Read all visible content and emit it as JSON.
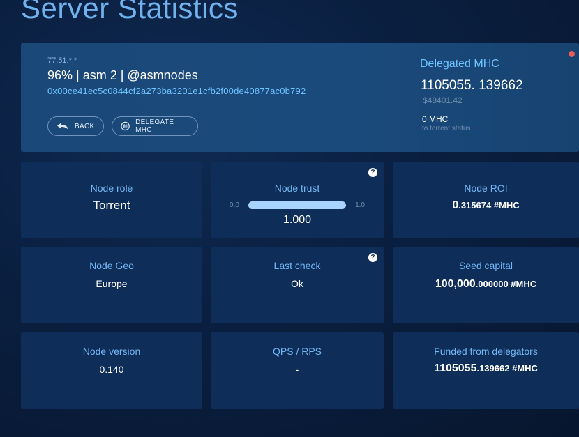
{
  "page": {
    "title": "Server Statistics"
  },
  "node": {
    "ip": "77.51.*.*",
    "name": "96% | asm 2 | @asmnodes",
    "address": "0x00ce41ec5c0844cf2a273ba3201e1cfb2f00de40877ac0b792",
    "back_label": "BACK",
    "delegate_label": "DELEGATE MHC"
  },
  "delegated": {
    "title": "Delegated MHC",
    "amount": "1105055. 139662",
    "usd": "$48401.42",
    "torrent_amount": "0 MHC",
    "torrent_status": "to torrent status"
  },
  "cards": {
    "role": {
      "label": "Node role",
      "value": "Torrent"
    },
    "trust": {
      "label": "Node trust",
      "min": "0.0",
      "max": "1.0",
      "value": "1.000",
      "level": 1.0
    },
    "roi": {
      "label": "Node ROI",
      "int": "0",
      "dec": ".315674 #MHC"
    },
    "geo": {
      "label": "Node Geo",
      "value": "Europe"
    },
    "check": {
      "label": "Last check",
      "value": "Ok"
    },
    "seed": {
      "label": "Seed capital",
      "int": "100,000",
      "dec": ".000000 #MHC"
    },
    "version": {
      "label": "Node version",
      "value": "0.140"
    },
    "qps": {
      "label": "QPS / RPS",
      "value": "-"
    },
    "funded": {
      "label": "Funded from delegators",
      "int": "1105055",
      "dec": ".139662 #MHC"
    }
  },
  "colors": {
    "accent": "#6fc3ff",
    "card_bg": "#0e2d59",
    "alert": "#ef5b5b"
  },
  "icons": {
    "back": "back-arrow-icon",
    "delegate": "hash-coin-icon",
    "help": "question-icon"
  }
}
